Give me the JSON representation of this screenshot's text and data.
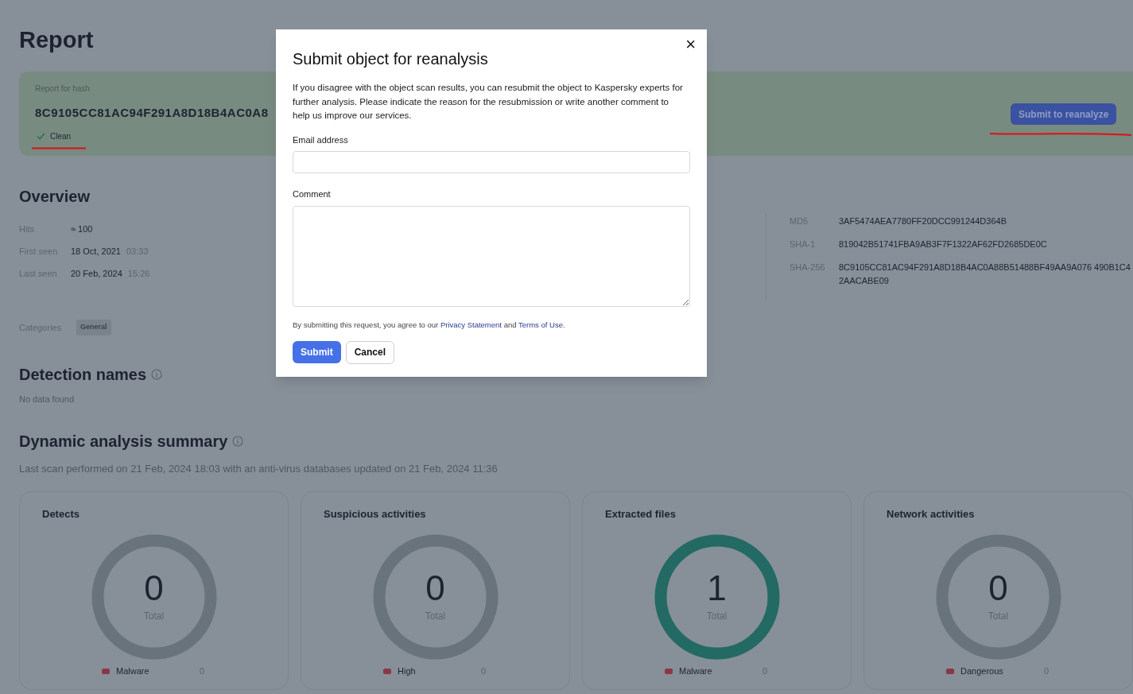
{
  "page": {
    "title": "Report"
  },
  "hash_card": {
    "label": "Report for hash",
    "hash": "8C9105CC81AC94F291A8D18B4AC0A8",
    "verdict": "Clean",
    "button": "Submit to reanalyze"
  },
  "overview": {
    "title": "Overview",
    "rows": [
      {
        "label": "Hits",
        "value": "≈ 100"
      },
      {
        "label": "First seen",
        "value": "18 Oct, 2021",
        "time": "03:33"
      },
      {
        "label": "Last seen",
        "value": "20 Feb, 2024",
        "time": "15:26"
      }
    ],
    "hashes": [
      {
        "label": "MD5",
        "value": "3AF5474AEA7780FF20DCC991244D364B"
      },
      {
        "label": "SHA-1",
        "value": "819042B51741FBA9AB3F7F1322AF62FD2685DE0C"
      },
      {
        "label": "SHA-256",
        "value": "8C9105CC81AC94F291A8D18B4AC0A88B51488BF49AA9A076 490B1C42AACABE09"
      }
    ],
    "categories_label": "Categories",
    "categories": [
      "General"
    ]
  },
  "detection": {
    "title": "Detection names",
    "empty": "No data found"
  },
  "dynamic": {
    "title": "Dynamic analysis summary",
    "subtitle": "Last scan performed on 21 Feb, 2024 18:03 with an anti-virus databases updated on 21 Feb, 2024 11:36",
    "cards": [
      {
        "title": "Detects",
        "total": "0",
        "total_label": "Total",
        "color": "#69737c",
        "legend": {
          "label": "Malware",
          "value": "0",
          "color": "#8a3848"
        }
      },
      {
        "title": "Suspicious activities",
        "total": "0",
        "total_label": "Total",
        "color": "#69737c",
        "legend": {
          "label": "High",
          "value": "0",
          "color": "#8a3848"
        }
      },
      {
        "title": "Extracted files",
        "total": "1",
        "total_label": "Total",
        "color": "#226a63",
        "legend": {
          "label": "Malware",
          "value": "0",
          "color": "#8a3848"
        }
      },
      {
        "title": "Network activities",
        "total": "0",
        "total_label": "Total",
        "color": "#69737c",
        "legend": {
          "label": "Dangerous",
          "value": "0",
          "color": "#8a3848"
        }
      }
    ]
  },
  "dialog": {
    "title": "Submit object for reanalysis",
    "close": "×",
    "description": "If you disagree with the object scan results, you can resubmit the object to Kaspersky experts for further analysis. Please indicate the reason for the resubmission or write another comment to help us improve our services.",
    "email_label": "Email address",
    "comment_label": "Comment",
    "consent_prefix": "By submitting this request, you agree to our",
    "privacy_link": "Privacy Statement",
    "consent_and": "and",
    "terms_link": "Terms of Use",
    "consent_suffix": ".",
    "submit": "Submit",
    "cancel": "Cancel"
  }
}
